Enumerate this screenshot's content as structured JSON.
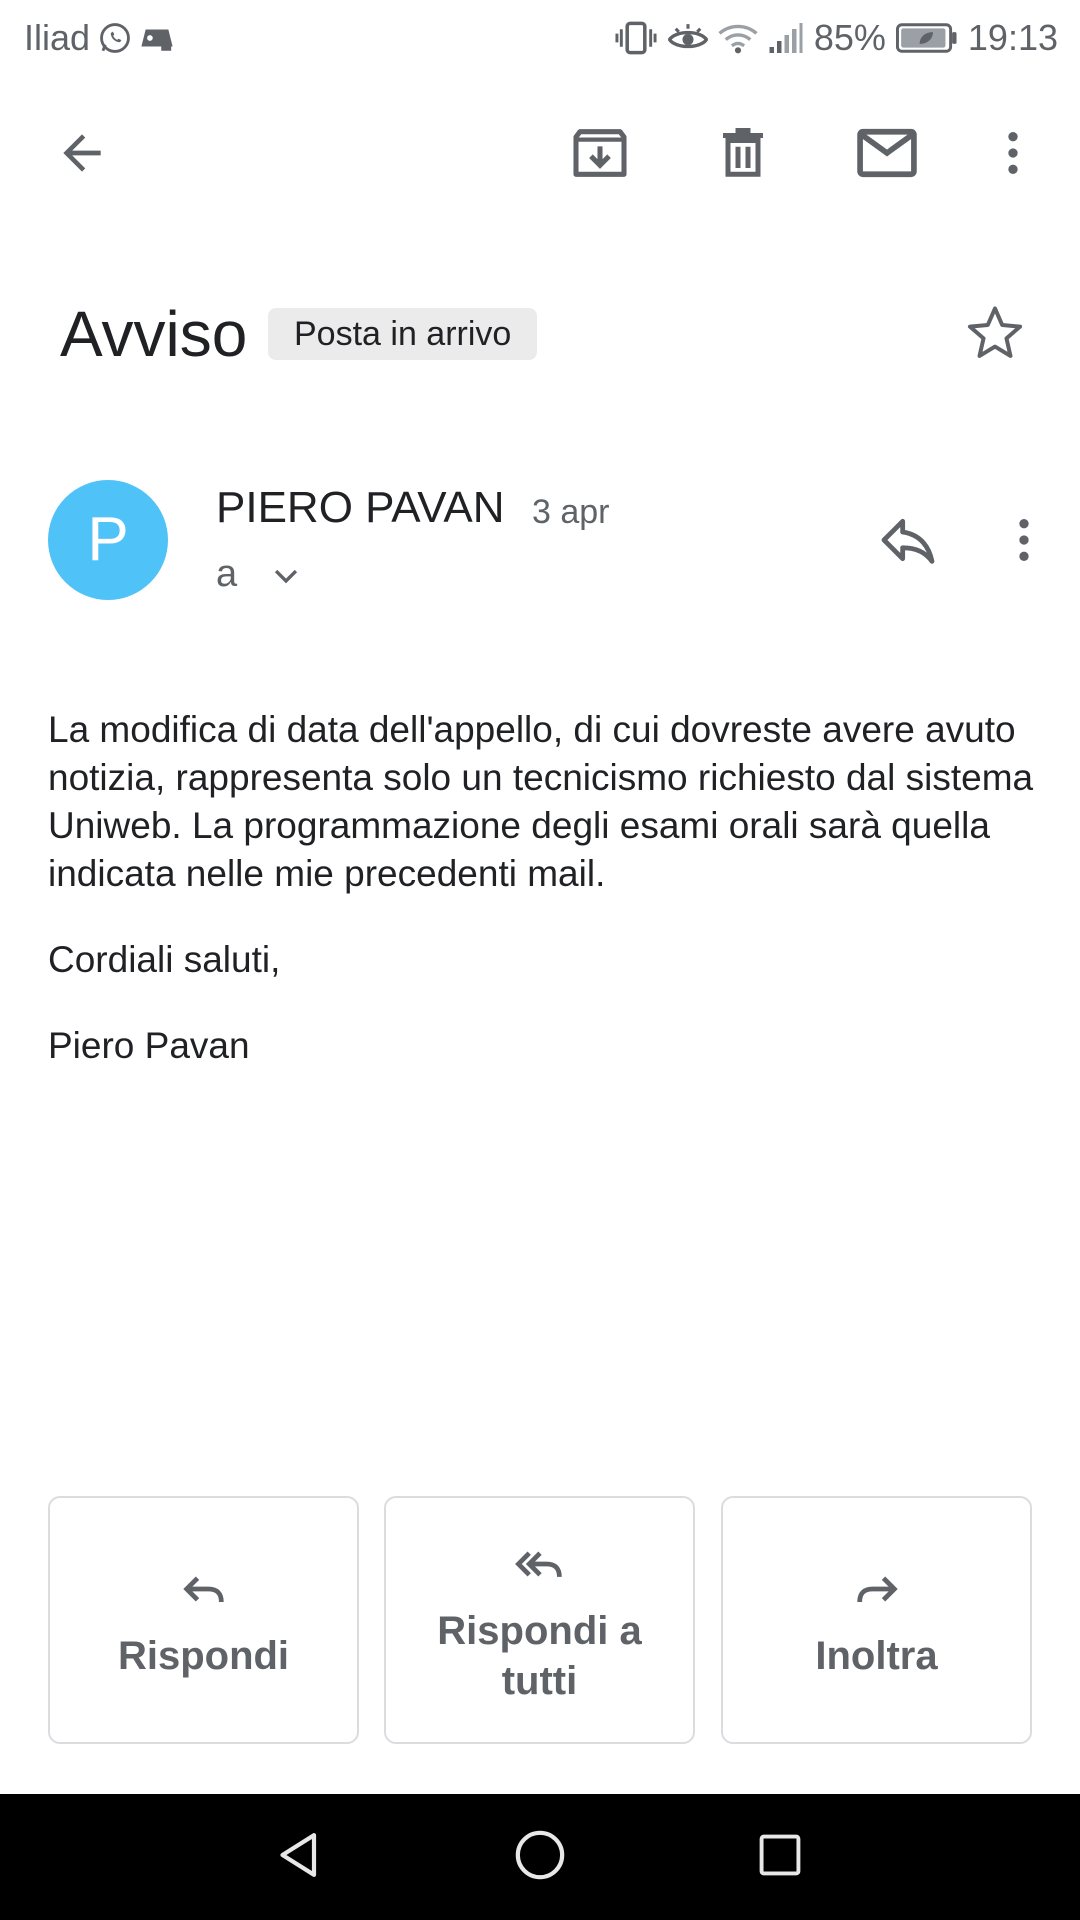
{
  "status_bar": {
    "carrier": "Iliad",
    "battery_percent": "85%",
    "time": "19:13",
    "left_icons": [
      "whatsapp-icon",
      "game-controller-icon"
    ],
    "right_icons": [
      "vibrate-icon",
      "eye-comfort-icon",
      "wifi-icon",
      "signal-icon",
      "battery-icon"
    ]
  },
  "toolbar": {
    "icons": [
      "back-arrow-icon",
      "archive-icon",
      "delete-icon",
      "mark-unread-icon",
      "more-vert-icon"
    ]
  },
  "email": {
    "subject": "Avviso",
    "label": "Posta in arrivo",
    "sender_initial": "P",
    "sender_name": "PIERO PAVAN",
    "date": "3 apr",
    "recipient": "a",
    "body": [
      "La modifica di data dell'appello, di cui dovreste avere avuto notizia, rappresenta solo un tecnicismo richiesto dal sistema Uniweb. La programmazione degli esami orali sarà quella indicata nelle mie precedenti mail.",
      "Cordiali saluti,",
      "Piero Pavan"
    ]
  },
  "actions": {
    "reply": "Rispondi",
    "reply_all": "Rispondi a tutti",
    "forward": "Inoltra"
  },
  "colors": {
    "avatar": "#4fc3f7",
    "text_primary": "#202124",
    "text_secondary": "#5f6368",
    "chip_background": "#ebebeb",
    "button_border": "#dadce0",
    "nav_bar": "#000000"
  }
}
